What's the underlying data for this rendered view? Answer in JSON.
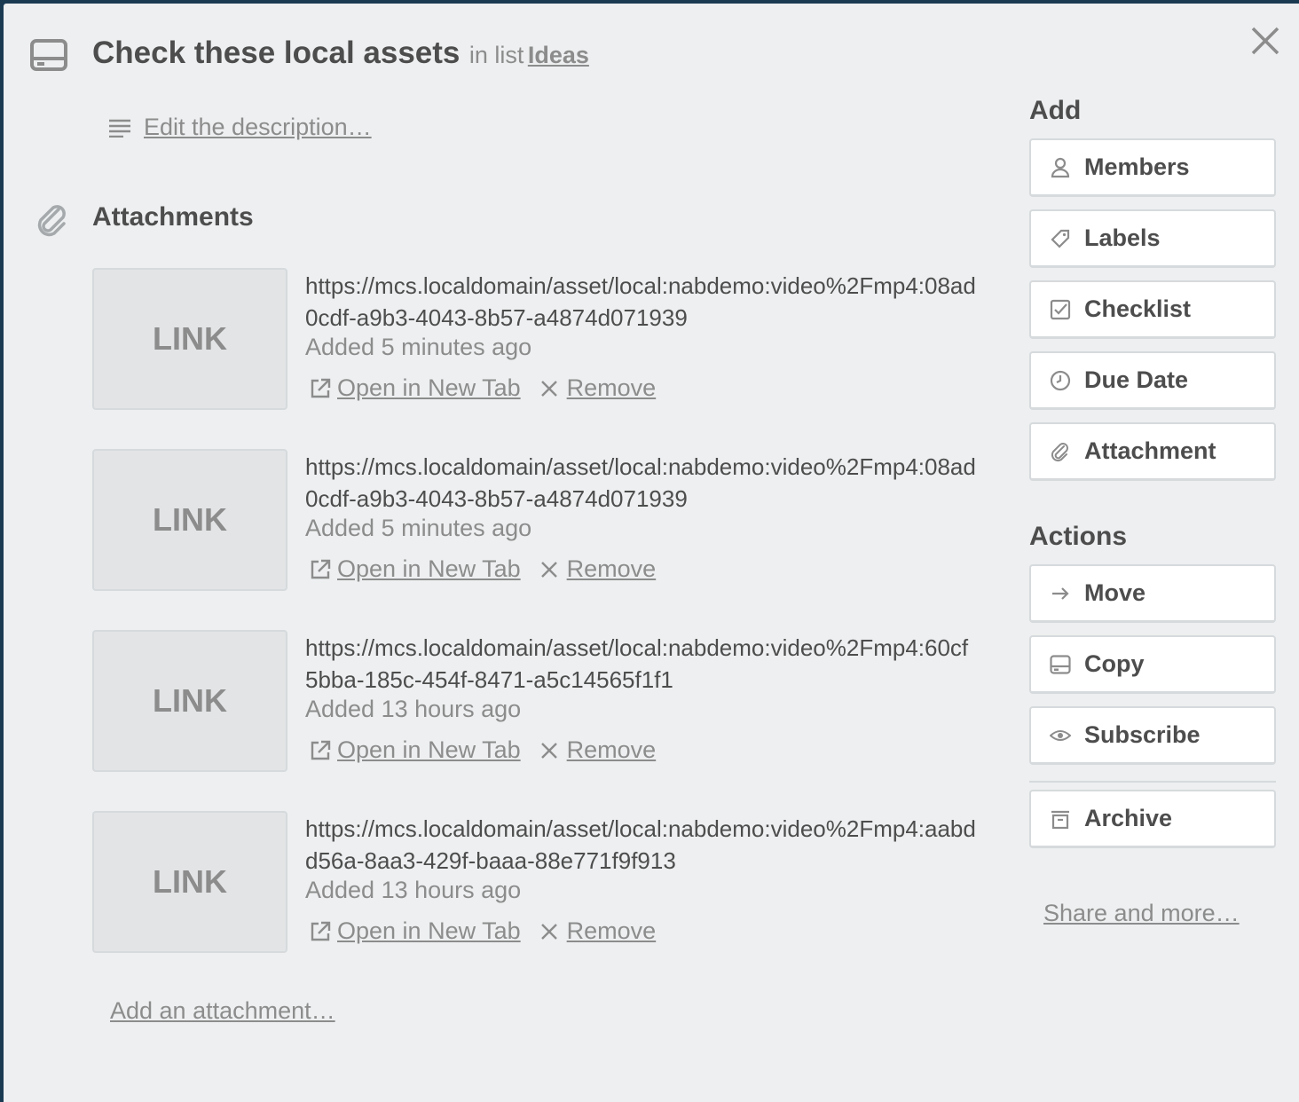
{
  "card": {
    "title": "Check these local assets",
    "in_list_prefix": "in list",
    "list_name": "Ideas",
    "description_link": "Edit the description…"
  },
  "attachments": {
    "heading": "Attachments",
    "items": [
      {
        "thumb_label": "LINK",
        "url": "https://mcs.localdomain/asset/local:nabdemo:video%2Fmp4:08ad0cdf-a9b3-4043-8b57-a4874d071939",
        "added": "Added 5 minutes ago",
        "open_label": "Open in New Tab",
        "remove_label": "Remove"
      },
      {
        "thumb_label": "LINK",
        "url": "https://mcs.localdomain/asset/local:nabdemo:video%2Fmp4:08ad0cdf-a9b3-4043-8b57-a4874d071939",
        "added": "Added 5 minutes ago",
        "open_label": "Open in New Tab",
        "remove_label": "Remove"
      },
      {
        "thumb_label": "LINK",
        "url": "https://mcs.localdomain/asset/local:nabdemo:video%2Fmp4:60cf5bba-185c-454f-8471-a5c14565f1f1",
        "added": "Added 13 hours ago",
        "open_label": "Open in New Tab",
        "remove_label": "Remove"
      },
      {
        "thumb_label": "LINK",
        "url": "https://mcs.localdomain/asset/local:nabdemo:video%2Fmp4:aabdd56a-8aa3-429f-baaa-88e771f9f913",
        "added": "Added 13 hours ago",
        "open_label": "Open in New Tab",
        "remove_label": "Remove"
      }
    ],
    "add_link": "Add an attachment…"
  },
  "sidebar": {
    "add_heading": "Add",
    "add_buttons": [
      {
        "label": "Members",
        "icon": "person-icon"
      },
      {
        "label": "Labels",
        "icon": "tag-icon"
      },
      {
        "label": "Checklist",
        "icon": "checkbox-icon"
      },
      {
        "label": "Due Date",
        "icon": "clock-icon"
      },
      {
        "label": "Attachment",
        "icon": "paperclip-icon"
      }
    ],
    "actions_heading": "Actions",
    "action_buttons": [
      {
        "label": "Move",
        "icon": "arrow-right-icon"
      },
      {
        "label": "Copy",
        "icon": "card-icon"
      },
      {
        "label": "Subscribe",
        "icon": "eye-icon"
      },
      {
        "label": "Archive",
        "icon": "archive-icon"
      }
    ],
    "share_link": "Share and more…"
  },
  "colors": {
    "modal_bg": "#edeff0",
    "text_dark": "#4d4d4d",
    "text_muted": "#8c8c8c",
    "button_bg": "#ffffff"
  }
}
